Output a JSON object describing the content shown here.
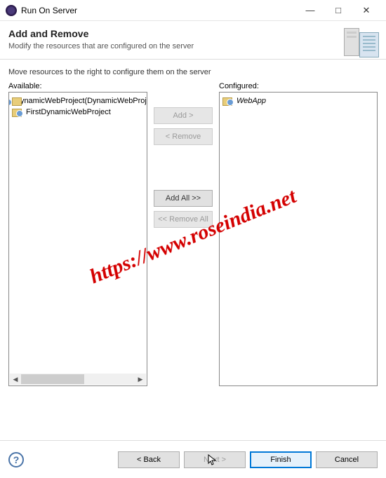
{
  "window": {
    "title": "Run On Server"
  },
  "header": {
    "title": "Add and Remove",
    "subtitle": "Modify the resources that are configured on the server"
  },
  "content": {
    "instruction": "Move resources to the right to configure them on the server",
    "available_label": "Available:",
    "configured_label": "Configured:",
    "available_items": [
      "DynamicWebProject(DynamicWebProject)",
      "FirstDynamicWebProject"
    ],
    "configured_items": [
      "WebApp"
    ]
  },
  "buttons": {
    "add": "Add >",
    "remove": "< Remove",
    "add_all": "Add All >>",
    "remove_all": "<< Remove All",
    "back": "< Back",
    "next": "Next >",
    "finish": "Finish",
    "cancel": "Cancel"
  },
  "watermark": "https://www.roseindia.net"
}
